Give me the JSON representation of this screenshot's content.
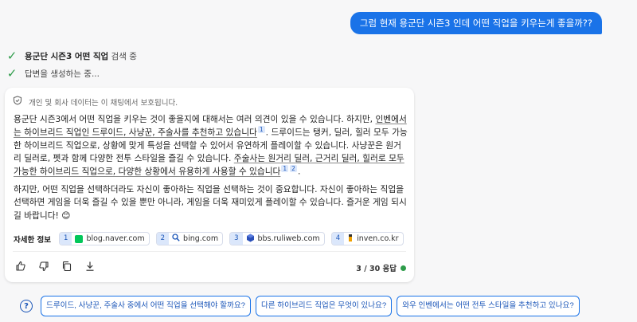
{
  "user_message": "그럼 현재 용군단 시즌3 인데 어떤 직업을 키우는게 좋을까??",
  "status": [
    {
      "bold": "용군단 시즌3 어떤 직업",
      "rest": " 검색 중"
    },
    {
      "bold": "",
      "rest": "답변을 생성하는 중..."
    }
  ],
  "privacy_note": "개인 및 회사 데이터는 이 채팅에서 보호됩니다.",
  "answer": {
    "p1_a": "용군단 시즌3에서 어떤 직업을 키우는 것이 좋을지에 대해서는 여러 의견이 있을 수 있습니다. 하지만, ",
    "p1_b": "인벤에서는 하이브리드 직업인 드루이드, 사냥꾼, 주술사를 추천하고 있습니다",
    "p1_c": ". 드루이드는 탱커, 딜러, 힐러 모두 가능한 하이브리드 직업으로, 상황에 맞게 특성을 선택할 수 있어서 유연하게 플레이할 수 있습니다. 사냥꾼은 원거리 딜러로, 펫과 함께 다양한 전투 스타일을 즐길 수 있습니다. ",
    "p1_d": "주술사는 원거리 딜러, 근거리 딜러, 힐러로 모두 가능한 하이브리드 직업으로, 다양한 상황에서 유용하게 사용할 수 있습니다",
    "p1_e": ".",
    "p2": "하지만, 어떤 직업을 선택하더라도 자신이 좋아하는 직업을 선택하는 것이 중요합니다. 자신이 좋아하는 직업을 선택하면 게임을 더욱 즐길 수 있을 뿐만 아니라, 게임을 더욱 재미있게 플레이할 수 있습니다. 즐거운 게임 되시길 바랍니다! 😊",
    "cite_1": "1",
    "cite_2a": "1",
    "cite_2b": "2"
  },
  "sources_title": "자세한 정보",
  "sources": [
    {
      "num": "1",
      "label": "blog.naver.com",
      "icon": "naver-blog-icon",
      "color": "#03c75a"
    },
    {
      "num": "2",
      "label": "bing.com",
      "icon": "search-icon",
      "color": "#1a55b8"
    },
    {
      "num": "3",
      "label": "bbs.ruliweb.com",
      "icon": "ruliweb-icon",
      "color": "#2a4fb8"
    },
    {
      "num": "4",
      "label": "inven.co.kr",
      "icon": "inven-icon",
      "color": "#f0a000"
    }
  ],
  "response_count": "3 / 30 응답",
  "status_color": "#2e9c4a",
  "suggestions": [
    "드루이드, 사냥꾼, 주술사 중에서 어떤 직업을 선택해야 할까요?",
    "다른 하이브리드 직업은 무엇이 있나요?",
    "와우 인벤에서는 어떤 전투 스타일을 추천하고 있나요?"
  ]
}
